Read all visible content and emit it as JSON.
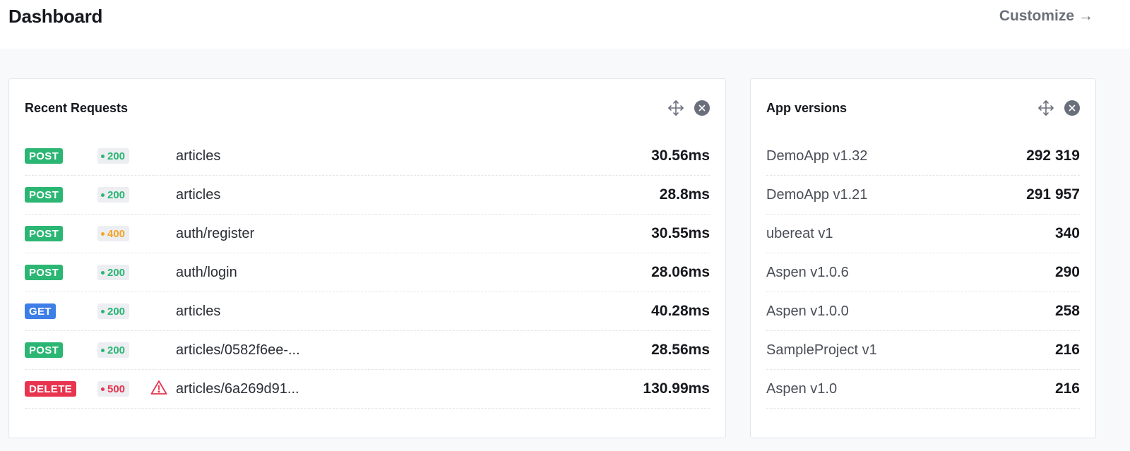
{
  "header": {
    "title": "Dashboard",
    "customize_label": "Customize",
    "customize_arrow": "→"
  },
  "colors": {
    "post": "#2bb673",
    "get": "#3d7ee8",
    "delete": "#e8344f",
    "status_ok": "#2bb673",
    "status_warn": "#f5a524",
    "status_error": "#e8344f"
  },
  "recent_requests": {
    "title": "Recent Requests",
    "rows": [
      {
        "method": "POST",
        "status": "200",
        "path": "articles",
        "duration": "30.56ms"
      },
      {
        "method": "POST",
        "status": "200",
        "path": "articles",
        "duration": "28.8ms"
      },
      {
        "method": "POST",
        "status": "400",
        "path": "auth/register",
        "duration": "30.55ms"
      },
      {
        "method": "POST",
        "status": "200",
        "path": "auth/login",
        "duration": "28.06ms"
      },
      {
        "method": "GET",
        "status": "200",
        "path": "articles",
        "duration": "40.28ms"
      },
      {
        "method": "POST",
        "status": "200",
        "path": "articles/0582f6ee-...",
        "duration": "28.56ms"
      },
      {
        "method": "DELETE",
        "status": "500",
        "path": "articles/6a269d91...",
        "duration": "130.99ms"
      }
    ]
  },
  "app_versions": {
    "title": "App versions",
    "rows": [
      {
        "name": "DemoApp v1.32",
        "count": "292 319"
      },
      {
        "name": "DemoApp v1.21",
        "count": "291 957"
      },
      {
        "name": "ubereat v1",
        "count": "340"
      },
      {
        "name": "Aspen v1.0.6",
        "count": "290"
      },
      {
        "name": "Aspen v1.0.0",
        "count": "258"
      },
      {
        "name": "SampleProject v1",
        "count": "216"
      },
      {
        "name": "Aspen v1.0",
        "count": "216"
      }
    ]
  }
}
